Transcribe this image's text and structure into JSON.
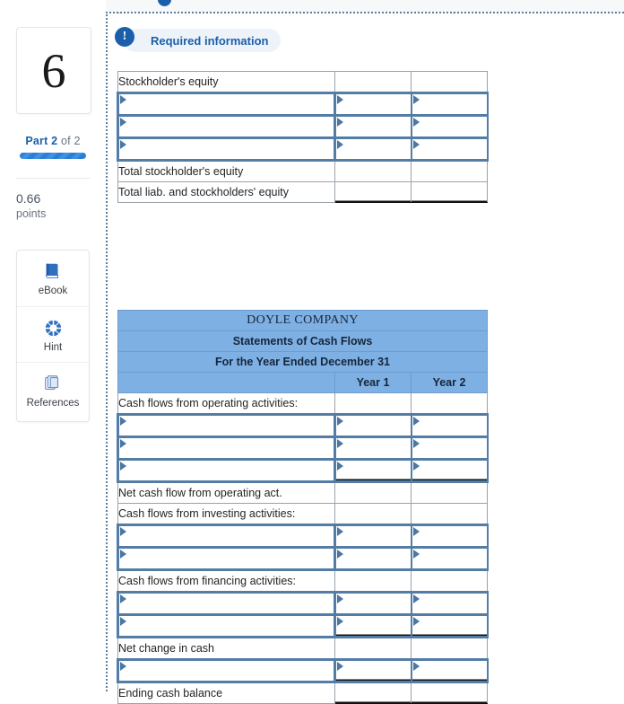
{
  "sidebar": {
    "question_number": "6",
    "part_prefix": "Part",
    "part_current": "2",
    "part_of": "of 2",
    "points_value": "0.66",
    "points_label": "points",
    "tools": [
      {
        "label": "eBook",
        "icon": "book-icon"
      },
      {
        "label": "Hint",
        "icon": "lifebuoy-icon"
      },
      {
        "label": "References",
        "icon": "documents-icon"
      }
    ]
  },
  "banner": {
    "label": "Required information",
    "icon": "exclamation-circle-icon"
  },
  "top_table": {
    "rows": [
      {
        "type": "label",
        "label": "Stockholder's equity",
        "y1": "",
        "y2": ""
      },
      {
        "type": "input",
        "label": "",
        "y1": "",
        "y2": ""
      },
      {
        "type": "input",
        "label": "",
        "y1": "",
        "y2": ""
      },
      {
        "type": "input",
        "label": "",
        "y1": "",
        "y2": ""
      },
      {
        "type": "total",
        "label": "Total stockholder's equity",
        "y1": "",
        "y2": ""
      },
      {
        "type": "grandtotal",
        "label": "Total liab. and stockholders' equity",
        "y1": "",
        "y2": ""
      }
    ]
  },
  "cash_flow_table": {
    "company": "DOYLE COMPANY",
    "statement_title": "Statements of Cash Flows",
    "period": "For the Year Ended December 31",
    "col_blank": "",
    "col_year1": "Year 1",
    "col_year2": "Year 2",
    "rows": [
      {
        "type": "label",
        "label": "Cash flows from operating activities:",
        "y1": "",
        "y2": ""
      },
      {
        "type": "input",
        "label": "",
        "y1": "",
        "y2": ""
      },
      {
        "type": "input",
        "label": "",
        "y1": "",
        "y2": ""
      },
      {
        "type": "input_ruled",
        "label": "",
        "y1": "",
        "y2": ""
      },
      {
        "type": "label",
        "label": "Net cash flow from operating act.",
        "y1": "",
        "y2": ""
      },
      {
        "type": "label",
        "label": "Cash flows from investing activities:",
        "y1": "",
        "y2": ""
      },
      {
        "type": "input",
        "label": "",
        "y1": "",
        "y2": ""
      },
      {
        "type": "input",
        "label": "",
        "y1": "",
        "y2": ""
      },
      {
        "type": "label",
        "label": "Cash flows from financing activities:",
        "y1": "",
        "y2": ""
      },
      {
        "type": "input",
        "label": "",
        "y1": "",
        "y2": ""
      },
      {
        "type": "input_ruled",
        "label": "",
        "y1": "",
        "y2": ""
      },
      {
        "type": "label",
        "label": "Net change in cash",
        "y1": "",
        "y2": ""
      },
      {
        "type": "input_ruled",
        "label": "",
        "y1": "",
        "y2": ""
      },
      {
        "type": "grandtotal",
        "label": "Ending cash balance",
        "y1": "",
        "y2": ""
      }
    ]
  },
  "colors": {
    "accent_blue": "#1b5faa",
    "header_blue": "#7fb0e4",
    "input_border": "#547da6",
    "banner_bg": "#eef3fa"
  }
}
